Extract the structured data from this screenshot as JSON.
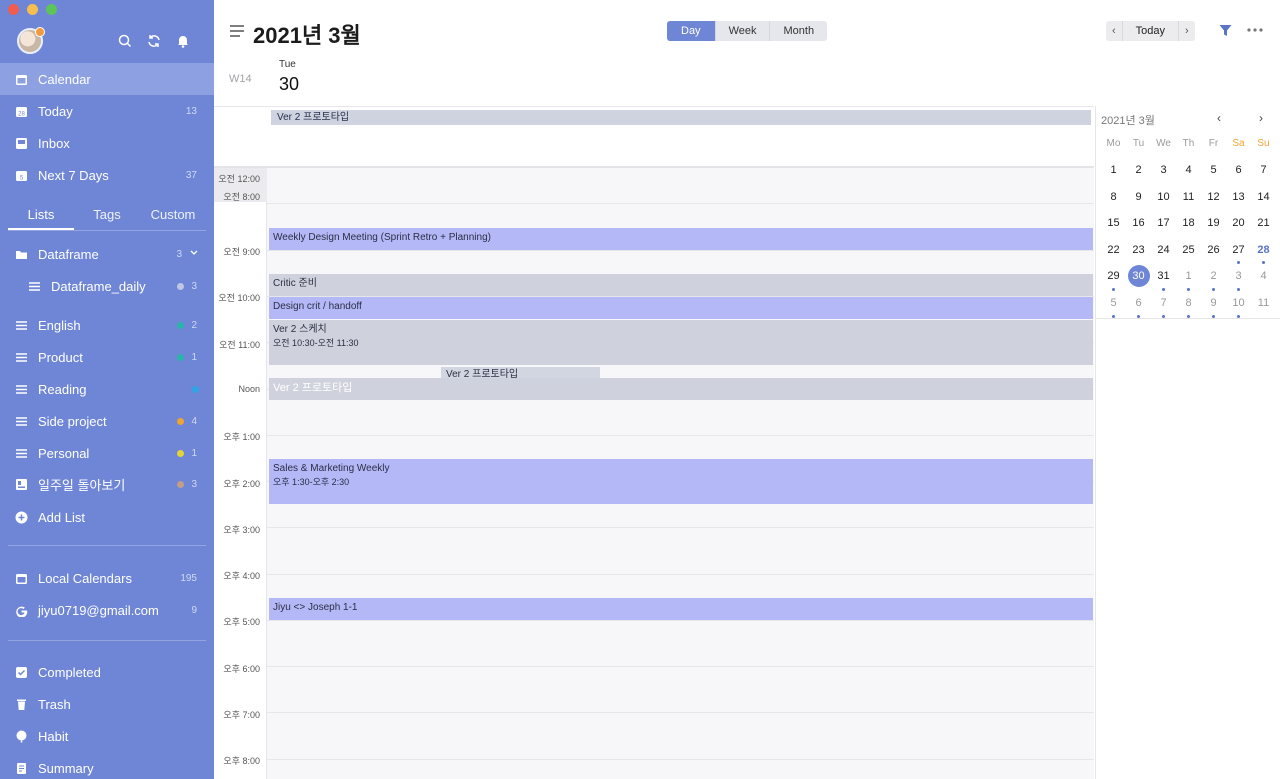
{
  "header": {
    "title": "2021년 3월",
    "views": [
      "Day",
      "Week",
      "Month"
    ],
    "active_view": "Day",
    "today_label": "Today",
    "prev": "‹",
    "next": "›",
    "week_label": "W14",
    "day_of_week": "Tue",
    "day_number": "30"
  },
  "sidebar": {
    "nav": [
      {
        "label": "Calendar",
        "count": "",
        "icon": "calendar-icon"
      },
      {
        "label": "Today",
        "count": "13",
        "icon": "today-icon"
      },
      {
        "label": "Inbox",
        "count": "",
        "icon": "inbox-icon"
      },
      {
        "label": "Next 7 Days",
        "count": "37",
        "icon": "next7-icon"
      }
    ],
    "tabs": [
      "Lists",
      "Tags",
      "Custom"
    ],
    "lists": [
      {
        "label": "Dataframe",
        "count": "3"
      },
      {
        "label": "Dataframe_daily",
        "count": "3",
        "dot": "#c0c6e4"
      },
      {
        "label": "English",
        "count": "2",
        "dot": "#2bb4a8"
      },
      {
        "label": "Product",
        "count": "1",
        "dot": "#2bb4a8"
      },
      {
        "label": "Reading",
        "count": "",
        "dot": "#2fa4e7"
      },
      {
        "label": "Side project",
        "count": "4",
        "dot": "#f0a431"
      },
      {
        "label": "Personal",
        "count": "1",
        "dot": "#e3d43a"
      },
      {
        "label": "일주일 돌아보기",
        "count": "3",
        "dot": "#c29e8a"
      }
    ],
    "add_list": "Add List",
    "calendars": [
      {
        "label": "Local Calendars",
        "count": "195"
      },
      {
        "label": "jiyu0719@gmail.com",
        "count": "9"
      }
    ],
    "bottom": [
      "Completed",
      "Trash",
      "Habit",
      "Summary"
    ]
  },
  "timeline": {
    "labels": [
      "오전 12:00",
      "오전 8:00",
      "오전 9:00",
      "오전 10:00",
      "오전 11:00",
      "Noon",
      "오후 1:00",
      "오후 2:00",
      "오후 3:00",
      "오후 4:00",
      "오후 5:00",
      "오후 6:00",
      "오후 7:00",
      "오후 8:00"
    ]
  },
  "events": {
    "allday": "Ver 2 프로토타입",
    "weekly": "Weekly Design Meeting (Sprint Retro + Planning)",
    "critic": "Critic 준비",
    "design_crit": "Design crit / handoff",
    "sketch": "Ver 2 스케치",
    "sketch_time": "오전 10:30-오전 11:30",
    "proto": "Ver 2 프로토타입",
    "proto_drag": "Ver 2 프로토타입",
    "sales": "Sales & Marketing Weekly",
    "sales_time": "오후 1:30-오후 2:30",
    "oneonone": "Jiyu <> Joseph 1-1"
  },
  "mini_calendar": {
    "title": "2021년 3월",
    "weekdays": [
      "Mo",
      "Tu",
      "We",
      "Th",
      "Fr",
      "Sa",
      "Su"
    ],
    "weeks": [
      [
        "1",
        "2",
        "3",
        "4",
        "5",
        "6",
        "7"
      ],
      [
        "8",
        "9",
        "10",
        "11",
        "12",
        "13",
        "14"
      ],
      [
        "15",
        "16",
        "17",
        "18",
        "19",
        "20",
        "21"
      ],
      [
        "22",
        "23",
        "24",
        "25",
        "26",
        "27",
        "28"
      ],
      [
        "29",
        "30",
        "31",
        "1",
        "2",
        "3",
        "4"
      ],
      [
        "5",
        "6",
        "7",
        "8",
        "9",
        "10",
        "11"
      ]
    ]
  }
}
